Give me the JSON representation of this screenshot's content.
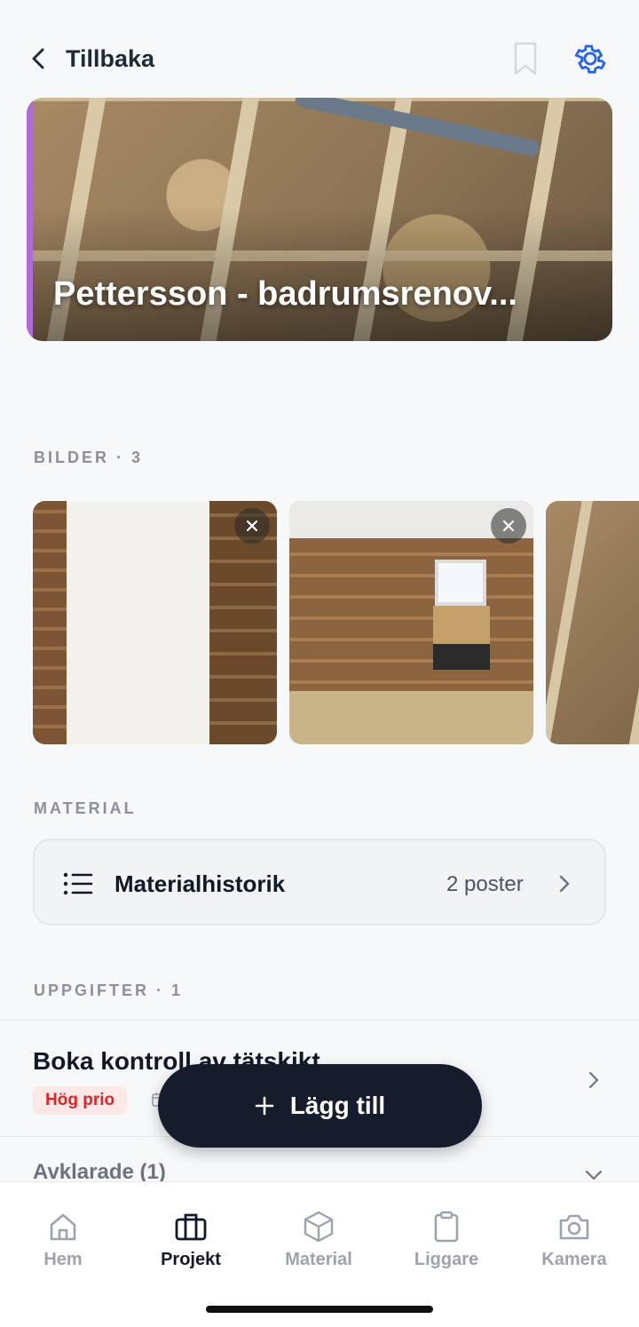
{
  "header": {
    "back_label": "Tillbaka",
    "accent_color": "#2563eb"
  },
  "project": {
    "title": "Pettersson - badrumsrenov..."
  },
  "images": {
    "label": "BILDER · 3"
  },
  "material": {
    "label": "MATERIAL",
    "history_title": "Materialhistorik",
    "history_count": "2 poster"
  },
  "tasks": {
    "label": "UPPGIFTER · 1",
    "items": [
      {
        "title": "Boka kontroll av tätskikt",
        "priority": "Hög prio"
      }
    ],
    "resolved_label": "Avklarade (1)"
  },
  "fab": {
    "label": "Lägg till"
  },
  "tabs": [
    {
      "label": "Hem",
      "icon": "home-icon",
      "active": false
    },
    {
      "label": "Projekt",
      "icon": "briefcase-icon",
      "active": true
    },
    {
      "label": "Material",
      "icon": "box-icon",
      "active": false
    },
    {
      "label": "Liggare",
      "icon": "clipboard-icon",
      "active": false
    },
    {
      "label": "Kamera",
      "icon": "camera-icon",
      "active": false
    }
  ]
}
